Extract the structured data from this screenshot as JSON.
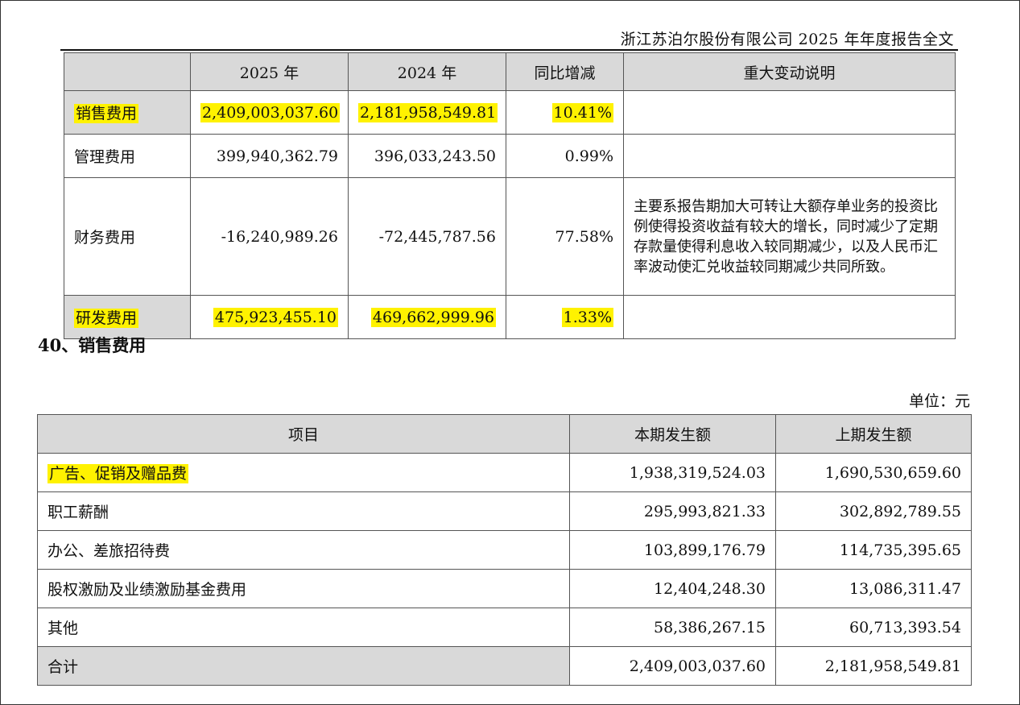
{
  "header": {
    "title": "浙江苏泊尔股份有限公司 2025 年年度报告全文"
  },
  "table1": {
    "headers": [
      "",
      "2025 年",
      "2024 年",
      "同比增减",
      "重大变动说明"
    ],
    "rows": [
      {
        "label": "销售费用",
        "y2025": "2,409,003,037.60",
        "y2024": "2,181,958,549.81",
        "change": "10.41%",
        "note": ""
      },
      {
        "label": "管理费用",
        "y2025": "399,940,362.79",
        "y2024": "396,033,243.50",
        "change": "0.99%",
        "note": ""
      },
      {
        "label": "财务费用",
        "y2025": "-16,240,989.26",
        "y2024": "-72,445,787.56",
        "change": "77.58%",
        "note": "主要系报告期加大可转让大额存单业务的投资比例使得投资收益有较大的增长，同时减少了定期存款量使得利息收入较同期减少，以及人民币汇率波动使汇兑收益较同期减少共同所致。"
      },
      {
        "label": "研发费用",
        "y2025": "475,923,455.10",
        "y2024": "469,662,999.96",
        "change": "1.33%",
        "note": ""
      }
    ]
  },
  "section": {
    "title": "40、销售费用",
    "unit": "单位：元"
  },
  "table2": {
    "headers": [
      "项目",
      "本期发生额",
      "上期发生额"
    ],
    "rows": [
      {
        "item": "广告、促销及赠品费",
        "current": "1,938,319,524.03",
        "previous": "1,690,530,659.60"
      },
      {
        "item": "职工薪酬",
        "current": "295,993,821.33",
        "previous": "302,892,789.55"
      },
      {
        "item": "办公、差旅招待费",
        "current": "103,899,176.79",
        "previous": "114,735,395.65"
      },
      {
        "item": "股权激励及业绩激励基金费用",
        "current": "12,404,248.30",
        "previous": "13,086,311.47"
      },
      {
        "item": "其他",
        "current": "58,386,267.15",
        "previous": "60,713,393.54"
      },
      {
        "item": "合计",
        "current": "2,409,003,037.60",
        "previous": "2,181,958,549.81"
      }
    ]
  },
  "colors": {
    "highlight": "#fff200",
    "header_bg": "#d9d9d9"
  }
}
